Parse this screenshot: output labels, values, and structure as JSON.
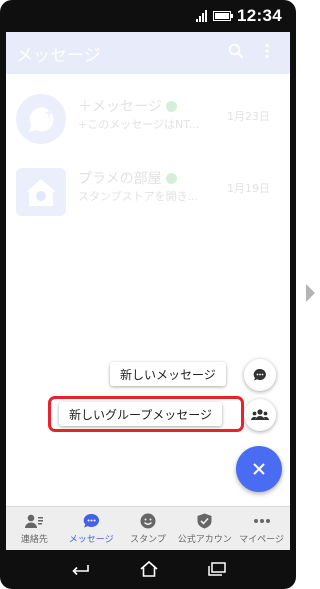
{
  "status_bar": {
    "time": "12:34"
  },
  "app_bar": {
    "title": "メッセージ",
    "search_icon": "search-icon",
    "menu_icon": "more-vert-icon"
  },
  "conversations": [
    {
      "name": "＋メッセージ",
      "preview": "+このメッセージはNT...",
      "date": "1月23日",
      "verified": true
    },
    {
      "name": "プラメの部屋",
      "preview": "スタンプストアを開き...",
      "date": "1月19日",
      "verified": true
    }
  ],
  "fab_menu": {
    "new_message": "新しいメッセージ",
    "new_group_message": "新しいグループメッセージ"
  },
  "tabs": [
    {
      "label": "連絡先",
      "icon": "contacts-icon",
      "active": false
    },
    {
      "label": "メッセージ",
      "icon": "chat-bubble-icon",
      "active": true
    },
    {
      "label": "スタンプ",
      "icon": "smile-icon",
      "active": false
    },
    {
      "label": "公式アカウン",
      "icon": "shield-check-icon",
      "active": false
    },
    {
      "label": "マイページ",
      "icon": "more-dots-icon",
      "active": false
    }
  ],
  "colors": {
    "accent": "#4a6cf3",
    "active_tab": "#4360e6",
    "highlight": "#e8212b",
    "app_bar_dimmed": "#e8ebf9"
  }
}
